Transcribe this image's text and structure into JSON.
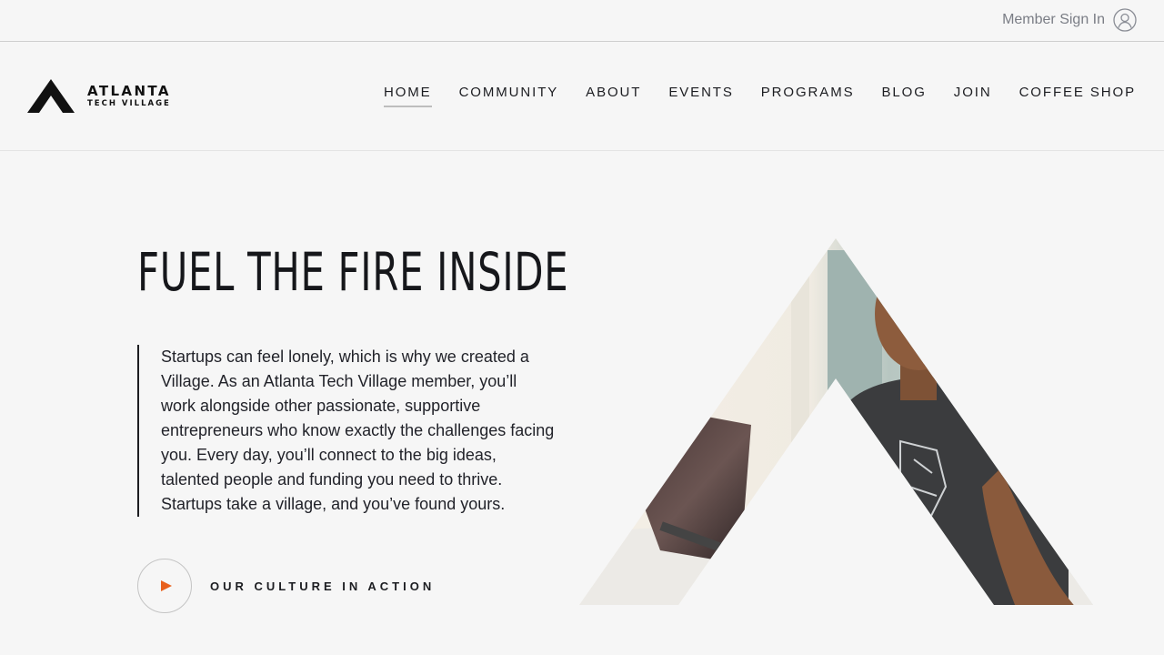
{
  "topbar": {
    "signin_label": "Member Sign In",
    "signin_icon": "user-circle-icon"
  },
  "logo": {
    "line1": "ATLANTA",
    "line2": "TECH VILLAGE"
  },
  "nav": {
    "items": [
      "HOME",
      "COMMUNITY",
      "ABOUT",
      "EVENTS",
      "PROGRAMS",
      "BLOG",
      "JOIN",
      "COFFEE SHOP"
    ],
    "active": "HOME"
  },
  "hero": {
    "title": "FUEL THE FIRE INSIDE",
    "body": "Startups can feel lonely, which is why we created a Village. As an Atlanta Tech Village member, you’ll work alongside other passionate, supportive entrepreneurs who know exactly the challenges facing you. Every day, you’ll connect to the big ideas, talented people and funding you need to thrive. Startups take a village, and you’ve found yours.",
    "cta_label": "OUR CULTURE IN ACTION",
    "cta_icon": "play-icon"
  },
  "colors": {
    "background": "#f6f6f6",
    "text": "#1c1d21",
    "accent": "#e8601c",
    "muted": "#7a7d85"
  }
}
